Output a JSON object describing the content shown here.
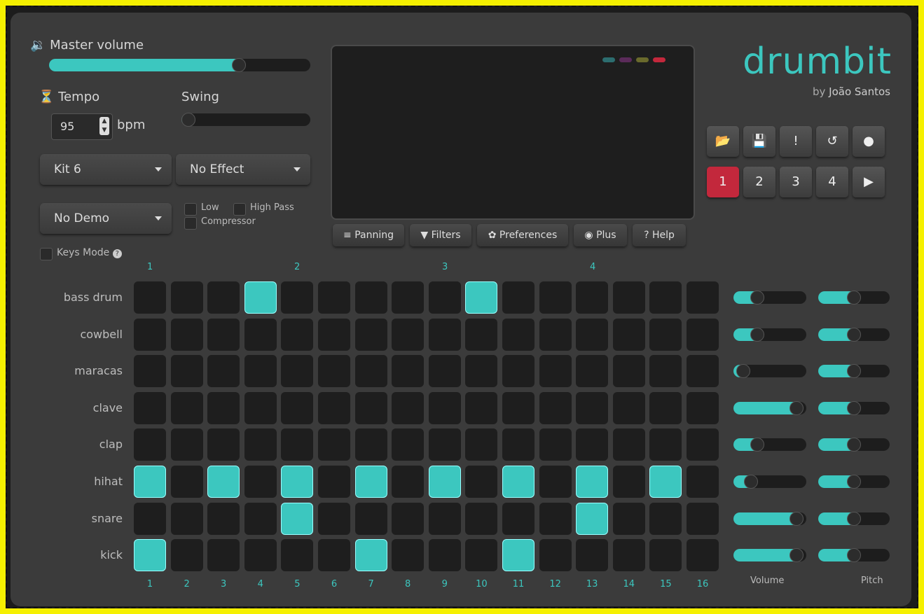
{
  "master_volume": {
    "label": "Master volume",
    "value": 0.74
  },
  "tempo": {
    "label": "Tempo",
    "value": "95",
    "unit": "bpm"
  },
  "swing": {
    "label": "Swing",
    "value": 0.0
  },
  "kit_select": {
    "value": "Kit 6"
  },
  "effect_select": {
    "value": "No Effect"
  },
  "demo_select": {
    "value": "No Demo"
  },
  "filters": {
    "low": "Low",
    "high_pass": "High Pass",
    "compressor": "Compressor"
  },
  "keys_mode": {
    "label": "Keys Mode",
    "help": "?"
  },
  "leds": [
    "#2c6d6f",
    "#5b2b5a",
    "#6a6a2c",
    "#c3283c"
  ],
  "tool_buttons": [
    {
      "label": "Panning",
      "icon": "≡"
    },
    {
      "label": "Filters",
      "icon": "▼"
    },
    {
      "label": "Preferences",
      "icon": "✿"
    },
    {
      "label": "Plus",
      "icon": "◉"
    },
    {
      "label": "Help",
      "icon": "?"
    }
  ],
  "logo": {
    "title": "drumbit",
    "by": "by",
    "author": "João Santos"
  },
  "file_buttons": [
    "📂",
    "💾",
    "!",
    "↺",
    "●"
  ],
  "patterns": [
    "1",
    "2",
    "3",
    "4"
  ],
  "play_icon": "▶",
  "beat_markers": [
    "1",
    "2",
    "3",
    "4"
  ],
  "instruments": [
    {
      "name": "bass drum",
      "volume": 0.28,
      "pitch": 0.5,
      "steps": [
        4,
        10
      ]
    },
    {
      "name": "cowbell",
      "volume": 0.28,
      "pitch": 0.5,
      "steps": []
    },
    {
      "name": "maracas",
      "volume": 0.05,
      "pitch": 0.5,
      "steps": []
    },
    {
      "name": "clave",
      "volume": 0.95,
      "pitch": 0.5,
      "steps": []
    },
    {
      "name": "clap",
      "volume": 0.28,
      "pitch": 0.5,
      "steps": []
    },
    {
      "name": "hihat",
      "volume": 0.18,
      "pitch": 0.5,
      "steps": [
        1,
        3,
        5,
        7,
        9,
        11,
        13,
        15
      ]
    },
    {
      "name": "snare",
      "volume": 0.95,
      "pitch": 0.5,
      "steps": [
        5,
        13
      ]
    },
    {
      "name": "kick",
      "volume": 0.95,
      "pitch": 0.5,
      "steps": [
        1,
        7,
        11
      ]
    }
  ],
  "step_numbers": [
    "1",
    "2",
    "3",
    "4",
    "5",
    "6",
    "7",
    "8",
    "9",
    "10",
    "11",
    "12",
    "13",
    "14",
    "15",
    "16"
  ],
  "column_labels": {
    "volume": "Volume",
    "pitch": "Pitch"
  }
}
